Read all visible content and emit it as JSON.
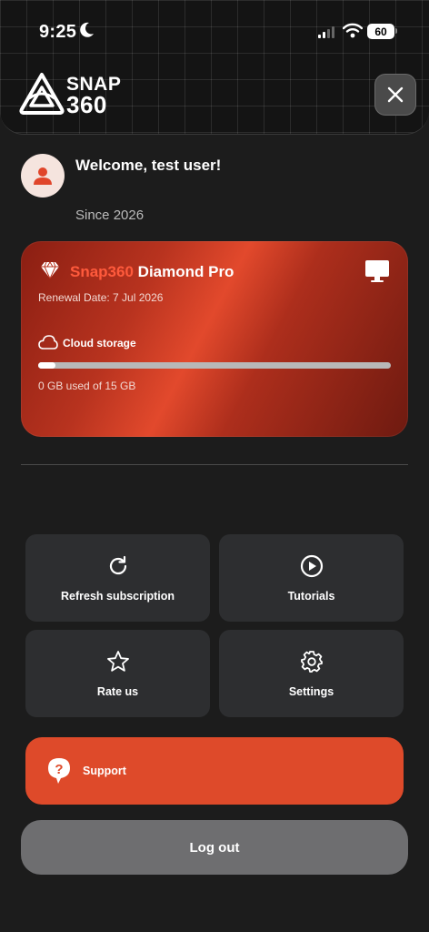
{
  "status_bar": {
    "time": "9:25",
    "battery": "60"
  },
  "header": {
    "logo_line1": "SNAP",
    "logo_line2": "360"
  },
  "user": {
    "welcome": "Welcome, test user!",
    "since": "Since 2026"
  },
  "plan": {
    "brand": "Snap360",
    "tier": " Diamond Pro",
    "renewal": "Renewal Date: 7 Jul 2026",
    "storage_label": "Cloud storage",
    "storage_text": "0 GB used of 15 GB",
    "storage_used_fraction": 0.05
  },
  "actions": [
    {
      "label": "Refresh subscription",
      "icon": "refresh-icon"
    },
    {
      "label": "Tutorials",
      "icon": "play-circle-icon"
    },
    {
      "label": "Rate us",
      "icon": "star-icon"
    },
    {
      "label": "Settings",
      "icon": "gear-icon"
    }
  ],
  "support": {
    "label": "Support"
  },
  "logout": {
    "label": "Log out"
  },
  "colors": {
    "accent": "#de4a2a",
    "background": "#1c1c1c",
    "tile": "#2d2e30",
    "brand_text": "#ff5a3c"
  }
}
